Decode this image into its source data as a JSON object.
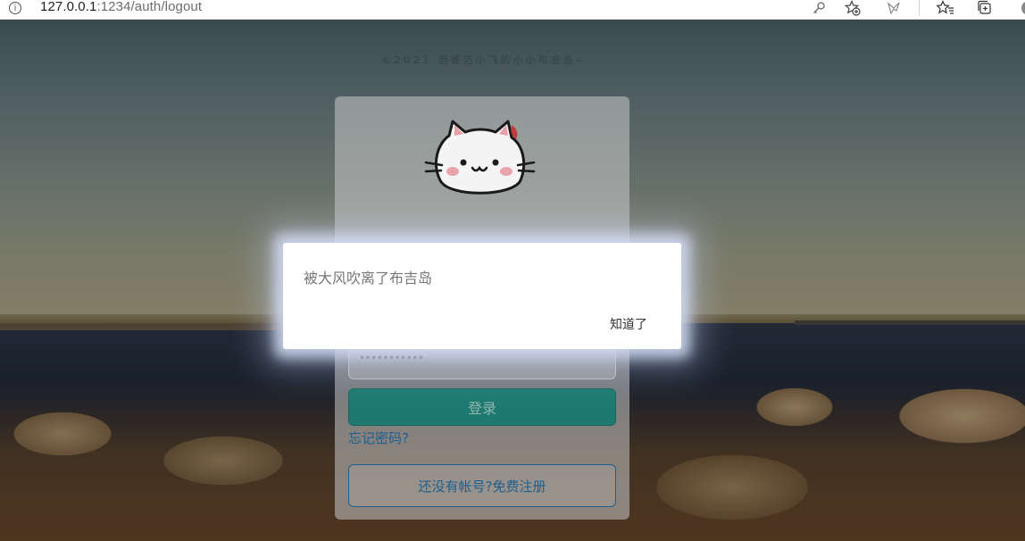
{
  "browser": {
    "url_host": "127.0.0.1",
    "url_path": ":1234/auth/logout",
    "icons": [
      "info-icon",
      "key-icon",
      "favorite-add-icon",
      "extension-icon",
      "favorites-icon",
      "collections-icon"
    ]
  },
  "page": {
    "copyright": "©2021 范哥范小飞的小小布吉岛~"
  },
  "login_card": {
    "logo": "cat-logo",
    "password_value": "•••••••••••",
    "login_label": "登录",
    "forgot_label": "忘记密码?",
    "register_label": "还没有帐号?免费注册"
  },
  "modal": {
    "message": "被大风吹离了布吉岛",
    "ok_label": "知道了"
  },
  "colors": {
    "primary_button": "#1e7a70",
    "link": "#1d5f8f",
    "modal_bg": "#ffffff"
  }
}
